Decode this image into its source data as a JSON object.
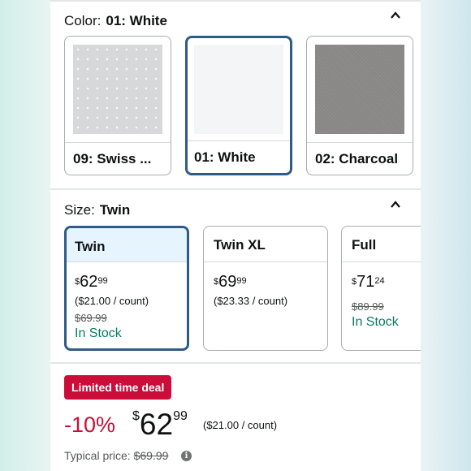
{
  "color_section": {
    "label": "Color:",
    "selected_value": "01: White",
    "swatches": [
      {
        "caption": "09: Swiss ...",
        "fill": "#d6d8da",
        "selected": false
      },
      {
        "caption": "01: White",
        "fill": "#f4f5f6",
        "selected": true
      },
      {
        "caption": "02: Charcoal",
        "fill": "#8e8c8a",
        "selected": false
      }
    ],
    "collapse_icon": "chevron-up-icon"
  },
  "size_section": {
    "label": "Size:",
    "selected_value": "Twin",
    "collapse_icon": "chevron-up-icon",
    "options": [
      {
        "name": "Twin",
        "currency": "$",
        "price_whole": "62",
        "price_fraction": "99",
        "per_count": "($21.00 / count)",
        "list_price": "$69.99",
        "stock": "In Stock",
        "selected": true
      },
      {
        "name": "Twin XL",
        "currency": "$",
        "price_whole": "69",
        "price_fraction": "99",
        "per_count": "($23.33 / count)",
        "list_price": "",
        "stock": "",
        "selected": false
      },
      {
        "name": "Full",
        "currency": "$",
        "price_whole": "71",
        "price_fraction": "24",
        "per_count": "",
        "list_price": "$89.99",
        "stock": "In Stock",
        "selected": false
      }
    ]
  },
  "deal": {
    "badge": "Limited time deal",
    "discount": "-10%",
    "currency": "$",
    "price_whole": "62",
    "price_fraction": "99",
    "per_count": "($21.00 / count)",
    "typical_label": "Typical price:",
    "typical_price": "$69.99",
    "info_icon": "info-icon"
  },
  "colors": {
    "selected_border": "#2e5b88",
    "selected_header_bg": "#e6f4fe",
    "deal_red": "#cc0c39",
    "in_stock_green": "#067d62"
  }
}
